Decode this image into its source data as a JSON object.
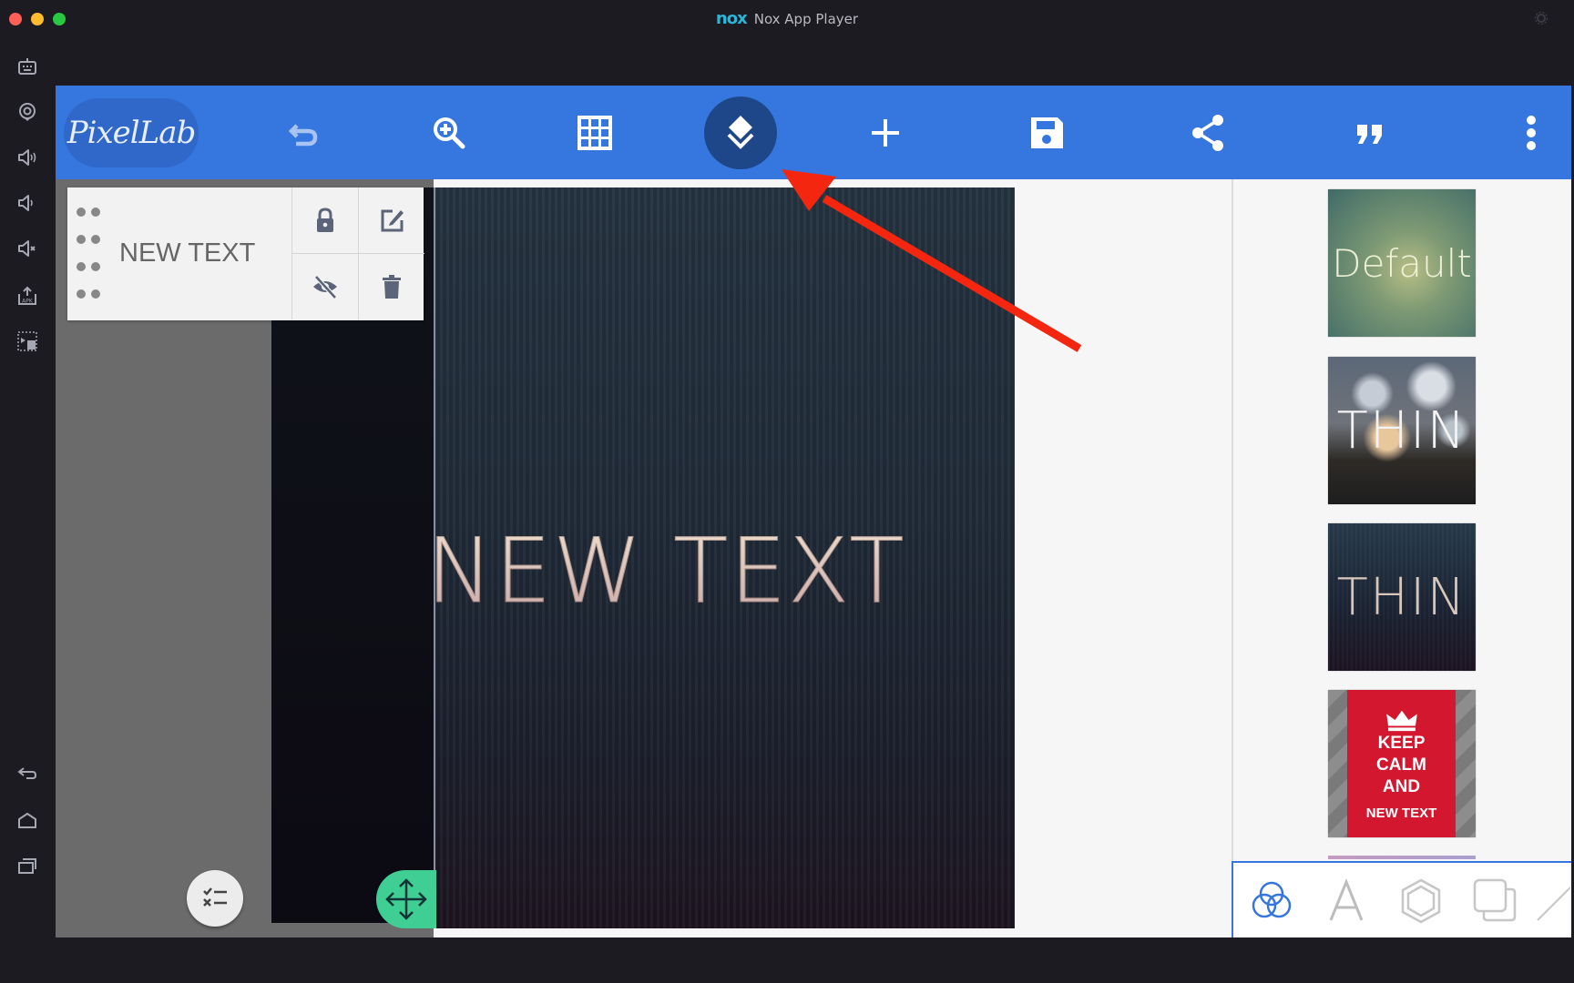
{
  "window": {
    "title": "Nox App Player",
    "brand_logo": "nox",
    "traffic_lights": {
      "close": "#fe5f57",
      "minimize": "#febc2e",
      "zoom": "#28c840"
    }
  },
  "nox_sidebar": {
    "top_items": [
      {
        "icon": "keyboard-robot-icon",
        "label": "Keyboard control"
      },
      {
        "icon": "location-icon",
        "label": "Location"
      },
      {
        "icon": "volume-up-icon",
        "label": "Volume up"
      },
      {
        "icon": "volume-down-icon",
        "label": "Volume down"
      },
      {
        "icon": "mute-icon",
        "label": "Mute"
      },
      {
        "icon": "apk-install-icon",
        "label": "Install APK"
      },
      {
        "icon": "screenshot-record-icon",
        "label": "Multi-drive"
      }
    ],
    "bottom_items": [
      {
        "icon": "back-icon",
        "label": "Back"
      },
      {
        "icon": "home-icon",
        "label": "Home"
      },
      {
        "icon": "recent-apps-icon",
        "label": "Recent apps"
      }
    ],
    "settings_icon": "gear-icon"
  },
  "toolbar": {
    "logo_text": "PixelLab",
    "accent_color": "#3576df",
    "buttons": [
      {
        "name": "undo",
        "icon": "undo-icon",
        "enabled": false
      },
      {
        "name": "zoom",
        "icon": "zoom-in-icon"
      },
      {
        "name": "grid",
        "icon": "grid-icon"
      },
      {
        "name": "layers",
        "icon": "layers-icon",
        "active": true
      },
      {
        "name": "add",
        "icon": "plus-icon"
      },
      {
        "name": "save",
        "icon": "save-icon"
      },
      {
        "name": "share",
        "icon": "share-icon"
      },
      {
        "name": "quotes",
        "icon": "quote-icon"
      },
      {
        "name": "more",
        "icon": "more-vertical-icon"
      }
    ]
  },
  "layer_panel": {
    "layers": [
      {
        "name": "NEW TEXT",
        "actions": [
          "lock",
          "edit",
          "hide",
          "delete"
        ]
      }
    ]
  },
  "canvas": {
    "text": "NEW TEXT"
  },
  "fabs": {
    "checklist": "checklist-icon",
    "move": "move-icon",
    "move_color": "#3fcf95"
  },
  "templates": [
    {
      "label": "Default"
    },
    {
      "label": "THIN"
    },
    {
      "label": "THIN"
    },
    {
      "lines": [
        "KEEP",
        "CALM",
        "AND"
      ],
      "sub": "NEW TEXT"
    }
  ],
  "bottom_tabs": [
    {
      "name": "styles",
      "icon": "circles-icon",
      "active": true
    },
    {
      "name": "text",
      "icon": "font-icon"
    },
    {
      "name": "shapes",
      "icon": "hexagon-icon"
    },
    {
      "name": "layers-copy",
      "icon": "overlap-squares-icon"
    },
    {
      "name": "draw",
      "icon": "pen-icon"
    }
  ],
  "annotation": {
    "type": "arrow",
    "color": "#f4260f",
    "points_to": "layers-button"
  }
}
